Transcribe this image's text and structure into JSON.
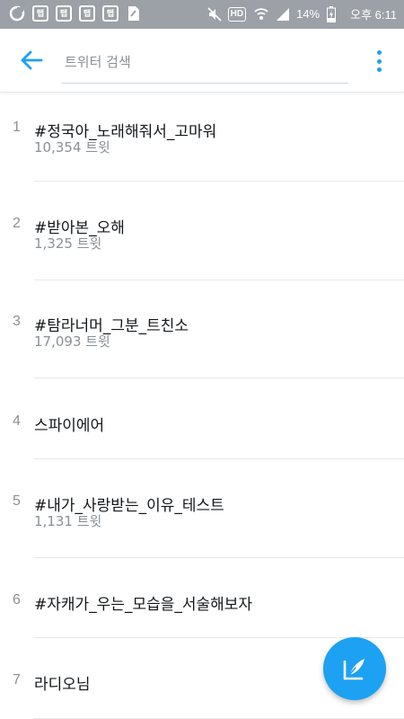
{
  "status_bar": {
    "left_icons": [
      "app-icon",
      "app-icon",
      "app-icon",
      "app-icon",
      "app-icon",
      "file-icon"
    ],
    "app_icon_label": "탭",
    "hd_label": "HD",
    "battery_percent": "14%",
    "time": "오후 6:11"
  },
  "toolbar": {
    "search_placeholder": "트위터 검색"
  },
  "trends": [
    {
      "rank": "1",
      "topic": "#정국아_노래해줘서_고마워",
      "count": "10,354 트윗"
    },
    {
      "rank": "2",
      "topic": "#받아본_오해",
      "count": "1,325 트윗"
    },
    {
      "rank": "3",
      "topic": "#탐라너머_그분_트친소",
      "count": "17,093 트윗"
    },
    {
      "rank": "4",
      "topic": "스파이에어",
      "count": ""
    },
    {
      "rank": "5",
      "topic": "#내가_사랑받는_이유_테스트",
      "count": "1,131 트윗"
    },
    {
      "rank": "6",
      "topic": "#자캐가_우는_모습을_서술해보자",
      "count": ""
    },
    {
      "rank": "7",
      "topic": "라디오님",
      "count": ""
    }
  ],
  "colors": {
    "accent": "#1da1f2",
    "status_bar": "#9ba1a6",
    "secondary_text": "#8a9096"
  }
}
